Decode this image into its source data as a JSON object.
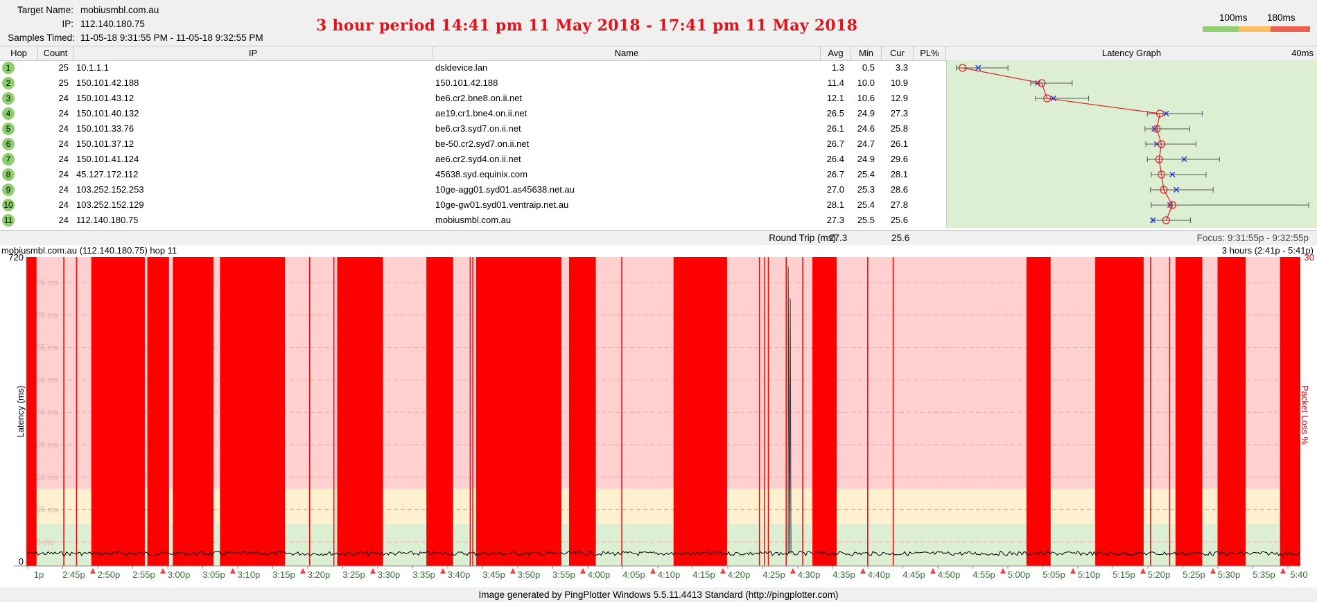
{
  "header": {
    "target_label": "Target Name:",
    "target_value": "mobiusmbl.com.au",
    "ip_label": "IP:",
    "ip_value": "112.140.180.75",
    "samples_label": "Samples Timed:",
    "samples_value": "11-05-18 9:31:55 PM - 11-05-18 9:32:55 PM",
    "banner": "3 hour period 14:41 pm 11 May 2018 - 17:41 pm 11 May 2018",
    "scale_100": "100ms",
    "scale_180": "180ms",
    "colors": {
      "good": "#90d070",
      "warn": "#ffc060",
      "bad": "#f06050"
    }
  },
  "table": {
    "columns": {
      "hop": "Hop",
      "count": "Count",
      "ip": "IP",
      "name": "Name",
      "avg": "Avg",
      "min": "Min",
      "cur": "Cur",
      "pl": "PL%",
      "graph": "Latency Graph",
      "graph_scale": "40ms"
    },
    "rows": [
      {
        "hop": "1",
        "count": "25",
        "ip": "10.1.1.1",
        "name": "dsldevice.lan",
        "avg": "1.3",
        "min": "0.5",
        "cur": "3.3"
      },
      {
        "hop": "2",
        "count": "25",
        "ip": "150.101.42.188",
        "name": "150.101.42.188",
        "avg": "11.4",
        "min": "10.0",
        "cur": "10.9"
      },
      {
        "hop": "3",
        "count": "24",
        "ip": "150.101.43.12",
        "name": "be6.cr2.bne8.on.ii.net",
        "avg": "12.1",
        "min": "10.6",
        "cur": "12.9"
      },
      {
        "hop": "4",
        "count": "24",
        "ip": "150.101.40.132",
        "name": "ae19.cr1.bne4.on.ii.net",
        "avg": "26.5",
        "min": "24.9",
        "cur": "27.3"
      },
      {
        "hop": "5",
        "count": "24",
        "ip": "150.101.33.76",
        "name": "be6.cr3.syd7.on.ii.net",
        "avg": "26.1",
        "min": "24.6",
        "cur": "25.8"
      },
      {
        "hop": "6",
        "count": "24",
        "ip": "150.101.37.12",
        "name": "be-50.cr2.syd7.on.ii.net",
        "avg": "26.7",
        "min": "24.7",
        "cur": "26.1"
      },
      {
        "hop": "7",
        "count": "24",
        "ip": "150.101.41.124",
        "name": "ae6.cr2.syd4.on.ii.net",
        "avg": "26.4",
        "min": "24.9",
        "cur": "29.6"
      },
      {
        "hop": "8",
        "count": "24",
        "ip": "45.127.172.112",
        "name": "45638.syd.equinix.com",
        "avg": "26.7",
        "min": "25.4",
        "cur": "28.1"
      },
      {
        "hop": "9",
        "count": "24",
        "ip": "103.252.152.253",
        "name": "10ge-agg01.syd01.as45638.net.au",
        "avg": "27.0",
        "min": "25.3",
        "cur": "28.6"
      },
      {
        "hop": "10",
        "count": "24",
        "ip": "103.252.152.129",
        "name": "10ge-gw01.syd01.ventraip.net.au",
        "avg": "28.1",
        "min": "25.4",
        "cur": "27.8"
      },
      {
        "hop": "11",
        "count": "24",
        "ip": "112.140.180.75",
        "name": "mobiusmbl.com.au",
        "avg": "27.3",
        "min": "25.5",
        "cur": "25.6"
      }
    ],
    "round_trip_label": "Round Trip (ms)",
    "round_trip_avg": "27.3",
    "round_trip_cur": "25.6",
    "focus": "Focus: 9:31:55p - 9:32:55p"
  },
  "timeline": {
    "title": "mobiusmbl.com.au (112.140.180.75) hop 11",
    "range": "3 hours (2:41p - 5:41p)",
    "y_top": "720",
    "y_bottom": "0",
    "pl_top": "30",
    "y_axis_label": "Latency (ms)",
    "pl_axis_label": "Packet Loss %",
    "y_ticks": [
      "75 ms",
      "00 ms",
      "25 ms",
      "50 ms",
      "75 ms",
      "00 ms",
      "25 ms",
      "50 ms",
      "5 ms"
    ],
    "x_ticks": [
      "1p",
      "2:45p",
      "2:50p",
      "2:55p",
      "3:00p",
      "3:05p",
      "3:10p",
      "3:15p",
      "3:20p",
      "3:25p",
      "3:30p",
      "3:35p",
      "3:40p",
      "3:45p",
      "3:50p",
      "3:55p",
      "4:00p",
      "4:05p",
      "4:10p",
      "4:15p",
      "4:20p",
      "4:25p",
      "4:30p",
      "4:35p",
      "4:40p",
      "4:45p",
      "4:50p",
      "4:55p",
      "5:00p",
      "5:05p",
      "5:10p",
      "5:15p",
      "5:20p",
      "5:25p",
      "5:30p",
      "5:35p",
      "5:40"
    ],
    "colors": {
      "loss": "#ff0000",
      "bg_bad": "#ffd0d0",
      "bg_warn": "#fff0d0",
      "bg_good": "#dcefd3",
      "trace": "#000000",
      "tick_text": "#2c6e2c"
    }
  },
  "footer": {
    "text": "Image generated by PingPlotter Windows 5.5.11.4413 Standard (http://pingplotter.com)"
  }
}
